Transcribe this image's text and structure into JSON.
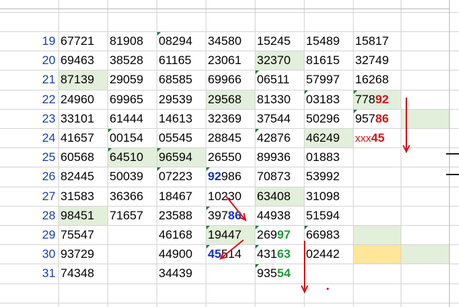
{
  "rows": [
    {
      "num": "19",
      "cells": [
        "67721",
        "81908",
        "08294",
        "34580",
        "15245",
        "15489",
        "15817",
        "",
        ""
      ]
    },
    {
      "num": "20",
      "cells": [
        "69463",
        "38528",
        "61165",
        "23061",
        "32370",
        "81615",
        "32749",
        "",
        ""
      ]
    },
    {
      "num": "21",
      "cells": [
        "87139",
        "29059",
        "68585",
        "69966",
        "06511",
        "57997",
        "16268",
        "",
        ""
      ]
    },
    {
      "num": "22",
      "cells": [
        "24960",
        "69965",
        "29539",
        "29568",
        "81330",
        "03183",
        "77892",
        "",
        ""
      ]
    },
    {
      "num": "23",
      "cells": [
        "33101",
        "61444",
        "14613",
        "32369",
        "37544",
        "50296",
        "95786",
        "",
        ""
      ]
    },
    {
      "num": "24",
      "cells": [
        "41657",
        "00154",
        "05545",
        "28845",
        "42876",
        "46249",
        "xxx45",
        "",
        ""
      ]
    },
    {
      "num": "25",
      "cells": [
        "60568",
        "64510",
        "96594",
        "26550",
        "89936",
        "01883",
        "",
        "",
        ""
      ]
    },
    {
      "num": "26",
      "cells": [
        "82445",
        "50039",
        "07223",
        "92986",
        "70873",
        "53992",
        "",
        "",
        ""
      ]
    },
    {
      "num": "27",
      "cells": [
        "31583",
        "36366",
        "18467",
        "10230",
        "63408",
        "31098",
        "",
        "",
        ""
      ]
    },
    {
      "num": "28",
      "cells": [
        "98451",
        "71657",
        "23588",
        "39786",
        "44938",
        "51594",
        "",
        "",
        ""
      ]
    },
    {
      "num": "29",
      "cells": [
        "75547",
        "",
        "46168",
        "19447",
        "26997",
        "66983",
        "",
        "",
        ""
      ]
    },
    {
      "num": "30",
      "cells": [
        "93729",
        "",
        "44900",
        "45514",
        "43163",
        "02442",
        "",
        "",
        ""
      ]
    },
    {
      "num": "31",
      "cells": [
        "74348",
        "",
        "34439",
        "",
        "93554",
        "",
        "",
        "",
        ""
      ]
    }
  ],
  "colors": {
    "green_fill": "#e2efda",
    "yellow_fill": "#ffe699",
    "row_number": "#1a3fb0",
    "highlight_red": "#d4141b",
    "highlight_blue": "#1232c8",
    "highlight_green": "#1f9a34",
    "gridline": "#d4d4d4"
  }
}
